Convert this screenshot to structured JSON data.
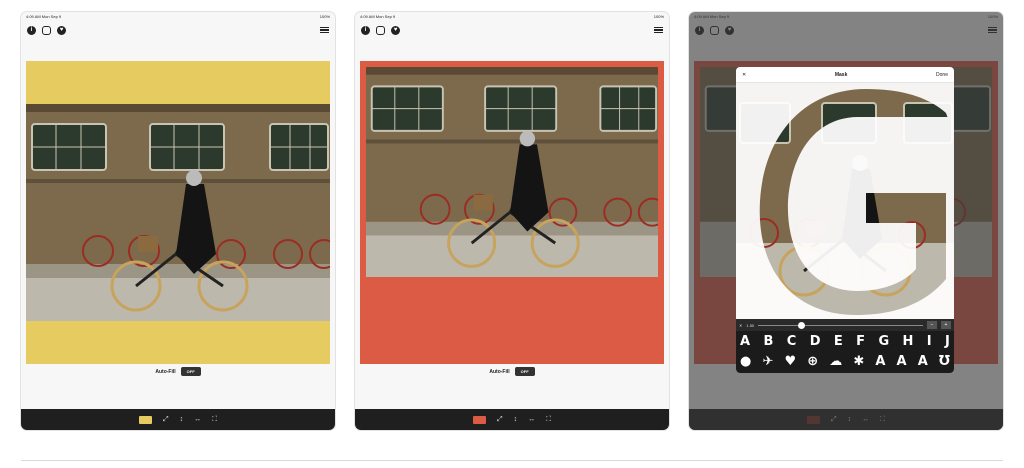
{
  "status": {
    "time": "4:09 AM  Mon Sep 9",
    "battery": "100%"
  },
  "toolbar": {
    "info_icon": "info-icon",
    "layers_icon": "layers-icon",
    "heart_icon": "heart-icon",
    "menu_icon": "menu-icon"
  },
  "colors": {
    "yellow": "#e6cc60",
    "red": "#dc5b45",
    "darkred": "#7a2f24"
  },
  "screens": [
    {
      "autofill_label": "Auto-Fill",
      "autofill_value": "OFF",
      "swatch": "#e6cc60"
    },
    {
      "autofill_label": "Auto-Fill",
      "autofill_value": "OFF",
      "swatch": "#dc5b45"
    },
    {
      "swatch": "#7a2f24"
    }
  ],
  "bottom_icons": [
    "expand-icon",
    "vertical-align-icon",
    "horizontal-align-icon",
    "fit-icon"
  ],
  "mask_modal": {
    "close": "✕",
    "title": "Mask",
    "done": "Done",
    "slider_close": "✕",
    "slider_value": "1.50",
    "minus": "−",
    "plus": "+",
    "row1": [
      "A",
      "B",
      "C",
      "D",
      "E",
      "F",
      "G",
      "H",
      "I",
      "J"
    ],
    "row2": [
      "speech-bubble-icon",
      "bird-icon",
      "heart-icon",
      "plus-circle-icon",
      "cloud-icon",
      "asterisk-icon",
      "A",
      "A",
      "A",
      "hook-icon"
    ]
  }
}
